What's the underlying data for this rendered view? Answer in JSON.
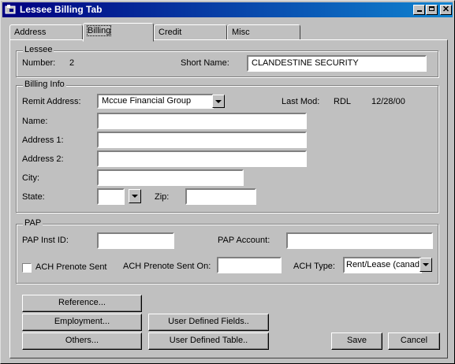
{
  "window": {
    "title": "Lessee Billing Tab"
  },
  "tabs": [
    {
      "label": "Address",
      "active": false
    },
    {
      "label": "Billing",
      "active": true
    },
    {
      "label": "Credit",
      "active": false
    },
    {
      "label": "Misc",
      "active": false
    }
  ],
  "lessee": {
    "legend": "Lessee",
    "number_label": "Number:",
    "number_value": "2",
    "short_name_label": "Short Name:",
    "short_name_value": "CLANDESTINE SECURITY"
  },
  "billing": {
    "legend": "Billing Info",
    "remit_label": "Remit Address:",
    "remit_value": "Mccue Financial Group",
    "last_mod_label": "Last Mod:",
    "last_mod_user": "RDL",
    "last_mod_date": "12/28/00",
    "name_label": "Name:",
    "address1_label": "Address 1:",
    "address2_label": "Address 2:",
    "city_label": "City:",
    "state_label": "State:",
    "zip_label": "Zip:"
  },
  "pap": {
    "legend": "PAP",
    "inst_label": "PAP Inst ID:",
    "account_label": "PAP Account:",
    "ach_prenote_label": "ACH Prenote Sent",
    "ach_prenote_checked": false,
    "ach_prenote_on_label": "ACH Prenote Sent On:",
    "ach_type_label": "ACH Type:",
    "ach_type_value": "Rent/Lease (canad"
  },
  "buttons": {
    "reference": "Reference...",
    "employment": "Employment...",
    "others": "Others...",
    "user_fields": "User Defined Fields..",
    "user_table": "User Defined Table..",
    "save": "Save",
    "cancel": "Cancel"
  }
}
